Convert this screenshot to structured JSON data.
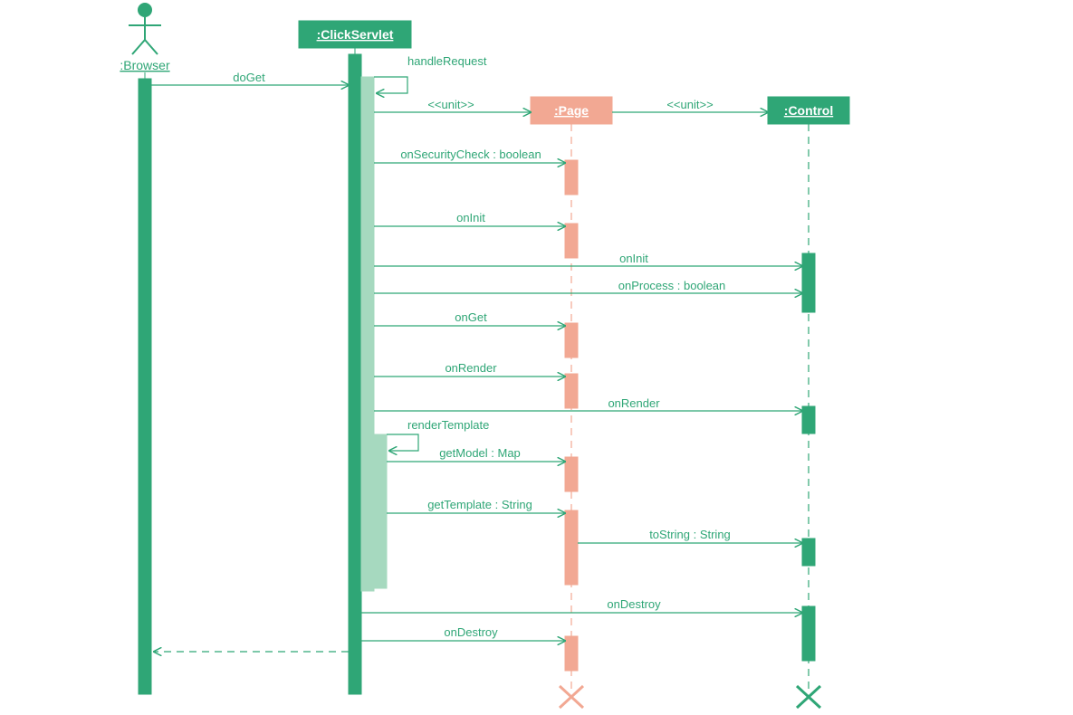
{
  "actors": {
    "browser": ":Browser",
    "clickServlet": ":ClickServlet",
    "page": ":Page",
    "control": ":Control"
  },
  "stereotypes": {
    "unit1": "<<unit>>",
    "unit2": "<<unit>>"
  },
  "messages": {
    "doGet": "doGet",
    "handleRequest": "handleRequest",
    "onSecurityCheck": "onSecurityCheck : boolean",
    "onInitPage": "onInit",
    "onInitControl": "onInit",
    "onProcess": "onProcess : boolean",
    "onGet": "onGet",
    "onRenderPage": "onRender",
    "onRenderControl": "onRender",
    "renderTemplate": "renderTemplate",
    "getModel": "getModel : Map",
    "getTemplate": "getTemplate : String",
    "toString": "toString : String",
    "onDestroyControl": "onDestroy",
    "onDestroyPage": "onDestroy"
  }
}
